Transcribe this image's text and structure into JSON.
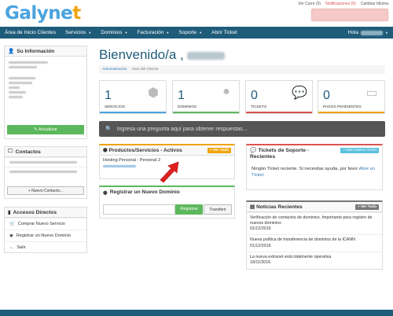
{
  "brand": {
    "name_main": "Galyne",
    "name_accent": "t"
  },
  "toplinks": {
    "cart": "Ver Carro (0)",
    "notifications": "Notificaciones (0)",
    "language": "Cambiar Idioma"
  },
  "nav": {
    "items": [
      "Área de Inicio Clientes",
      "Servicios",
      "Dominios",
      "Facturación",
      "Soporte",
      "Abrir Ticket"
    ],
    "greeting": "Hola"
  },
  "sidebar": {
    "info_title": "Su Información",
    "update_btn": "Actualizar",
    "contacts_title": "Contactos",
    "new_contact_btn": "Nuevo Contacto...",
    "shortcuts_title": "Accesos Directos",
    "shortcuts": [
      "Comprar Nuevo Servicio",
      "Registrar un Nuevo Dominio",
      "Salir"
    ]
  },
  "main": {
    "welcome": "Bienvenido/a ,",
    "breadcrumb": [
      "Administración",
      "Área del Cliente"
    ],
    "stats": [
      {
        "num": "1",
        "label": "SERVICIOS",
        "color": "#4aa3df",
        "icon": "cube-icon"
      },
      {
        "num": "1",
        "label": "DOMINIOS",
        "color": "#5cb85c",
        "icon": "globe-icon"
      },
      {
        "num": "0",
        "label": "TICKETS",
        "color": "#d9534f",
        "icon": "comments-icon"
      },
      {
        "num": "0",
        "label": "PAGOS PENDIENTES",
        "color": "#f0a30a",
        "icon": "credit-card-icon"
      }
    ],
    "search_placeholder": "Ingresa una pregunta aquí para obtener respuestas...",
    "products": {
      "title": "Productos/Servicios - Activos",
      "btn": "Ver Todo",
      "item": "Hosting Personal - Personal 2"
    },
    "tickets": {
      "title": "Tickets de Soporte - Recientes",
      "btn": "Abrir Nuevo Ticket",
      "text": "Ningún Ticket reciente. Si necesitas ayuda, por favor",
      "link": "Abre un Ticket."
    },
    "register": {
      "title": "Registrar un Nuevo Dominio",
      "register_btn": "Registrar",
      "transfer_btn": "Transferir"
    },
    "news": {
      "title": "Noticias Recientes",
      "btn": "Ver Todo",
      "items": [
        {
          "text": "Verificación de contactos de dominios. Importante para registro de nuevos dominios",
          "date": "01/12/2016"
        },
        {
          "text": "Nueva política de transferencia de dominios de la ICANN",
          "date": "01/12/2016"
        },
        {
          "text": "La nueva extranet está totalmente operativa",
          "date": "18/11/2016"
        }
      ]
    }
  }
}
